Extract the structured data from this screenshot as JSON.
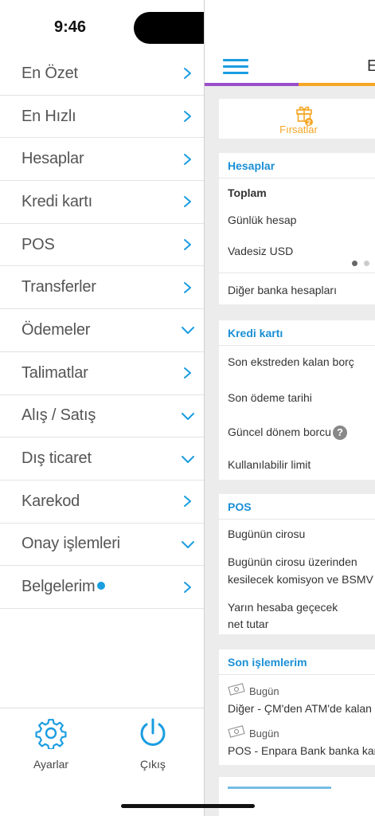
{
  "status": {
    "time": "9:46"
  },
  "menu": {
    "items": [
      {
        "label": "En Özet",
        "chevron": "chevron-right-icon"
      },
      {
        "label": "En Hızlı",
        "chevron": "chevron-right-icon"
      },
      {
        "label": "Hesaplar",
        "chevron": "chevron-right-icon"
      },
      {
        "label": "Kredi kartı",
        "chevron": "chevron-right-icon"
      },
      {
        "label": "POS",
        "chevron": "chevron-right-icon"
      },
      {
        "label": "Transferler",
        "chevron": "chevron-right-icon"
      },
      {
        "label": "Ödemeler",
        "chevron": "chevron-down-icon"
      },
      {
        "label": "Talimatlar",
        "chevron": "chevron-right-icon"
      },
      {
        "label": "Alış / Satış",
        "chevron": "chevron-down-icon"
      },
      {
        "label": "Dış ticaret",
        "chevron": "chevron-down-icon"
      },
      {
        "label": "Karekod",
        "chevron": "chevron-right-icon"
      },
      {
        "label": "Onay işlemleri",
        "chevron": "chevron-down-icon"
      },
      {
        "label": "Belgelerim",
        "chevron": "chevron-right-icon",
        "badge": true
      }
    ]
  },
  "bottom": {
    "settings_label": "Ayarlar",
    "logout_label": "Çıkış"
  },
  "colors": {
    "accent": "#1a9de0",
    "purple": "#9b4dca",
    "orange": "#f5a623"
  },
  "dashboard": {
    "header_letter": "E",
    "firsatlar_label": "Fırsatlar",
    "firsatlar_badge": "2",
    "hesaplar": {
      "title": "Hesaplar",
      "toplam": "Toplam",
      "rows": [
        "Günlük hesap",
        "Vadesiz USD"
      ],
      "other": "Diğer banka hesapları"
    },
    "kredi": {
      "title": "Kredi kartı",
      "rows": [
        "Son ekstreden kalan borç",
        "Son ödeme tarihi",
        "Güncel dönem borcu",
        "Kullanılabilir limit"
      ]
    },
    "pos": {
      "title": "POS",
      "row1": "Bugünün cirosu",
      "row2a": "Bugünün cirosu üzerinden",
      "row2b": "kesilecek komisyon ve BSMV",
      "row3a": "Yarın hesaba geçecek",
      "row3b": "net tutar"
    },
    "son": {
      "title": "Son işlemlerim",
      "tx": [
        {
          "date": "Bugün",
          "desc": "Diğer - ÇM'den ATM'de kalan tu"
        },
        {
          "date": "Bugün",
          "desc": "POS - Enpara Bank banka kart"
        }
      ]
    }
  }
}
